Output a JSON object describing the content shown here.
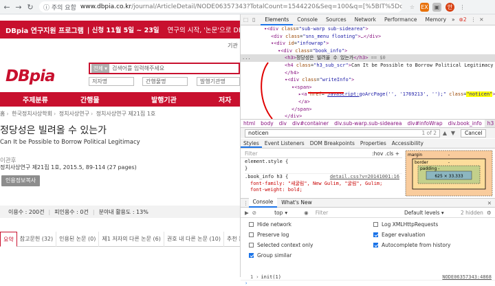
{
  "browser": {
    "security_label": "주의 요함",
    "url_host": "www.dbpia.co.kr",
    "url_path": "/journal/ArticleDetail/NODE06357343?TotalCount=1544220&Seq=100&q=[%5BIT%5Dcoldb%2$%5153%5D)&searc...",
    "ext_labels": [
      "EX",
      "안"
    ],
    "avatar_label": "안"
  },
  "page": {
    "banner_brand": "DBpia 연구지원 프로그램",
    "banner_date": "| 신청 11월 5일 ~ 23일",
    "banner_tail": "연구의 시작, '논문'으로 DBpia",
    "top_link": "기관",
    "logo": "DBpia",
    "search_select": "전체 ▾",
    "search_placeholder": "검색어를 입력해주세요",
    "sub_searches": [
      "저자명",
      "간행물명",
      "발행기관명"
    ],
    "nav": [
      "주제분류",
      "간행물",
      "발행기관",
      "저자"
    ],
    "breadcrumb": [
      "홈",
      "한국정치사상학회",
      "정치사상연구",
      "정치사상연구 제21집 1호"
    ],
    "title": "정당성은 빌려올 수 있는가",
    "subtitle": "Can It be Possible to Borrow Political Legitimacy",
    "author": "이관후",
    "pub_info": "정치사상연구 제21집 1호, 2015.5, 89-114 (27 pages)",
    "cite_button": "인용정보복사",
    "stats": [
      "이용수 : 200건",
      "피인용수 : 0건",
      "분야내 활용도 : 13%"
    ],
    "tabs": [
      "요약",
      "참고문헌 (32)",
      "인용된 논문 (0)",
      "제1 저자의 다른 논문 (6)",
      "권호 내 다른 논문 (10)",
      "추천 논문"
    ]
  },
  "devtools": {
    "tabs": [
      "Elements",
      "Console",
      "Sources",
      "Network",
      "Performance",
      "Memory"
    ],
    "more": "»",
    "errors": "2",
    "dom_lines": [
      {
        "indent": 6,
        "html": "<span class='tg'>▾&lt;div </span><span class='at'>class</span>=<span class='av'>\"sub-warp sub-sidearea\"</span><span class='tg'>&gt;</span>"
      },
      {
        "indent": 8,
        "html": "<span class='tg'>&lt;div </span><span class='at'>class</span>=<span class='av'>\"sns_menu floating\"</span><span class='tg'>&gt;…&lt;/div&gt;</span>"
      },
      {
        "indent": 8,
        "html": "<span class='tg'>▾&lt;div </span><span class='at'>id</span>=<span class='av'>\"infowrap\"</span><span class='tg'>&gt;</span>"
      },
      {
        "indent": 10,
        "html": "<span class='tg'>▾&lt;div </span><span class='at'>class</span>=<span class='av'>\"book_info\"</span><span class='tg'>&gt;</span>"
      },
      {
        "indent": 12,
        "html": "<span class='tg'>&lt;h3&gt;</span><span class='tx'>정당성은 빌려올 수 있는가</span><span class='tg'>&lt;/h3&gt;</span> <span class='cm'>== $0</span>",
        "selected": true
      },
      {
        "indent": 12,
        "html": "<span class='tg'>&lt;h4 </span><span class='at'>class</span>=<span class='av'>\"h3_sub_scr\"</span><span class='tg'>&gt;</span><span class='tx'>Can It be Possible to Borrow Political Legitimacy</span>"
      },
      {
        "indent": 12,
        "html": "<span class='tg'>&lt;/h4&gt;</span>"
      },
      {
        "indent": 12,
        "html": "<span class='tg'>▾&lt;div </span><span class='at'>class</span>=<span class='av'>\"writeInfo\"</span><span class='tg'>&gt;</span>"
      },
      {
        "indent": 14,
        "html": "<span class='tg'>▾&lt;span&gt;</span>"
      },
      {
        "indent": 16,
        "html": "<span class='tg'>▸&lt;a </span><span class='at'>href</span>=<span class='av'>\"<u>JavaScript:</u>goArcPage('', '1769213', '');\"</span> <span class='at'>class</span>=<span class='av' style='background:#ff0'>\"noticen\"</span><span class='tg'>&gt;…</span>"
      },
      {
        "indent": 16,
        "html": "<span class='tg'>&lt;/a&gt;</span>"
      },
      {
        "indent": 14,
        "html": "<span class='tg'>&lt;/span&gt;</span>"
      },
      {
        "indent": 12,
        "html": "<span class='tg'>&lt;/div&gt;</span>"
      },
      {
        "indent": 12,
        "html": "<span class='tg'>▸&lt;dl&gt;…&lt;/dl&gt;</span>"
      }
    ],
    "breadcrumb": [
      "html",
      "body",
      "div",
      "div#container",
      "div.sub-warp.sub-sidearea",
      "div#infoWrap",
      "div.book_info",
      "h3"
    ],
    "find_value": "noticen",
    "find_count": "1 of 2",
    "cancel": "Cancel",
    "style_tabs": [
      "Styles",
      "Event Listeners",
      "DOM Breakpoints",
      "Properties",
      "Accessibility"
    ],
    "filter_placeholder": "Filter",
    "filter_right": ":hov  .cls  +",
    "rule1": "element.style {",
    "rule1_end": "}",
    "rule2_sel": ".book_info h3 {",
    "rule2_link": "detail.css?v=20141001:16",
    "rule2_p1": "font-family: \"새굴림\", New Gulim, \"굴림\", Gulim;",
    "rule2_p2": "font-weight: bold;",
    "box_margin": "margin",
    "box_border": "border",
    "box_padding": "padding -",
    "box_content": "625 × 33.333",
    "box_dash": "-",
    "drawer_tabs": [
      "Console",
      "What's New"
    ],
    "context": "top",
    "console_filter": "Filter",
    "levels": "Default levels ▾",
    "hidden": "2 hidden",
    "options_left": [
      {
        "label": "Hide network",
        "checked": false
      },
      {
        "label": "Preserve log",
        "checked": false
      },
      {
        "label": "Selected context only",
        "checked": false
      },
      {
        "label": "Group similar",
        "checked": true
      }
    ],
    "options_right": [
      {
        "label": "Log XMLHttpRequests",
        "checked": false
      },
      {
        "label": "Eager evaluation",
        "checked": true
      },
      {
        "label": "Autocomplete from history",
        "checked": true
      }
    ],
    "console_line": "init(1)",
    "console_source": "NODE06357343:4868",
    "console_count": "1"
  },
  "colors": {
    "brand_red": "#c8102e",
    "devtools_blue": "#1a73e8"
  }
}
